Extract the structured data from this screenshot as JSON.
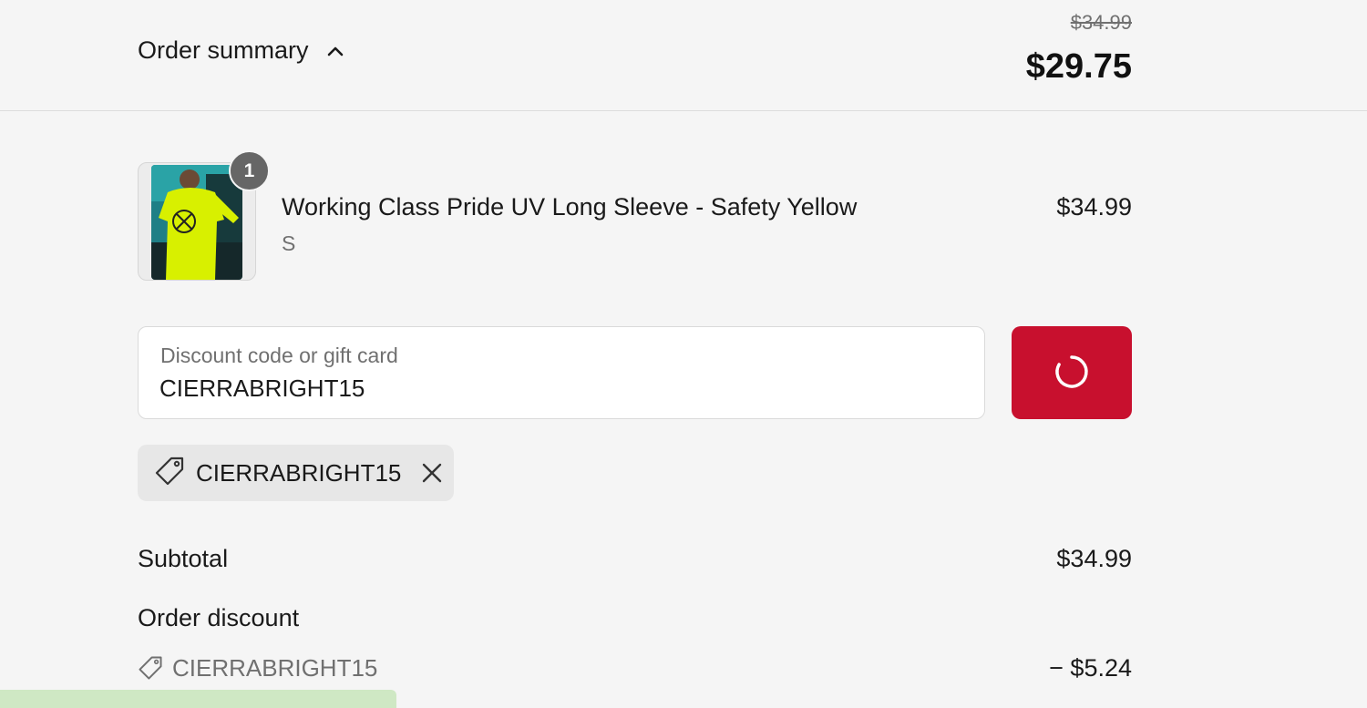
{
  "header": {
    "toggle_label": "Order summary",
    "original_total": "$34.99",
    "total": "$29.75"
  },
  "product": {
    "quantity": "1",
    "name": "Working Class Pride UV Long Sleeve - Safety Yellow",
    "variant": "S",
    "price": "$34.99"
  },
  "discount_field": {
    "label": "Discount code or gift card",
    "value": "CIERRABRIGHT15"
  },
  "applied_tag": {
    "code": "CIERRABRIGHT15"
  },
  "summary": {
    "subtotal_label": "Subtotal",
    "subtotal_value": "$34.99",
    "order_discount_label": "Order discount",
    "discount_code": "CIERRABRIGHT15",
    "discount_value": "− $5.24"
  },
  "colors": {
    "accent": "#c8102e",
    "background": "#f5f5f5",
    "muted_text": "#707070"
  }
}
